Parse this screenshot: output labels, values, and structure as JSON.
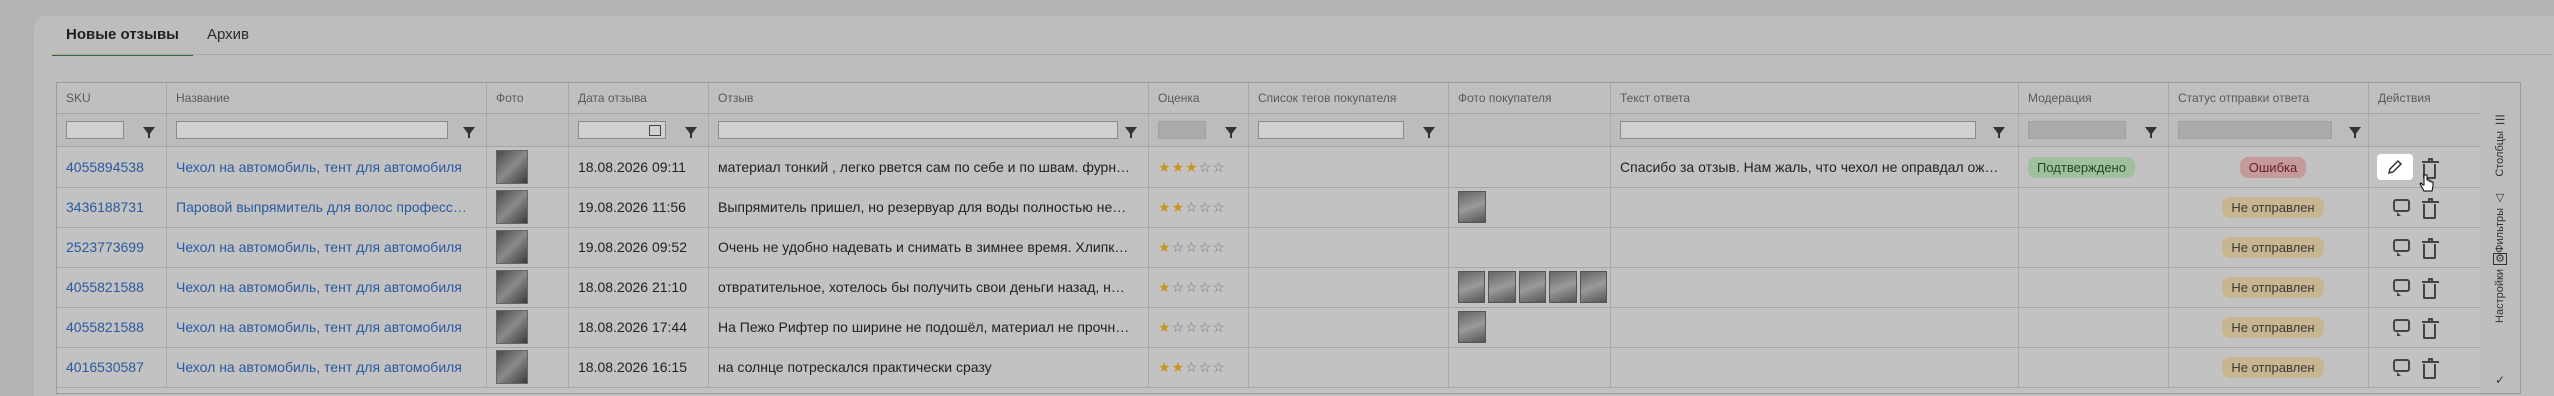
{
  "tabs": [
    {
      "label": "Новые отзывы",
      "active": true
    },
    {
      "label": "Архив",
      "active": false
    }
  ],
  "columns": [
    "SKU",
    "Название",
    "Фото",
    "Дата отзыва",
    "Отзыв",
    "Оценка",
    "Список тегов покупателя",
    "Фото покупателя",
    "Текст ответа",
    "Модерация",
    "Статус отправки ответа",
    "Действия"
  ],
  "rows": [
    {
      "sku": "4055894538",
      "name": "Чехол на автомобиль, тент для автомобиля",
      "date": "18.08.2026 09:11",
      "review": "материал тонкий , легко рвется сам по себе и по швам. фурн…",
      "stars": 3,
      "photos": 0,
      "answer": "Спасибо за отзыв. Нам жаль, что чехол не оправдал ож…",
      "moderation": "Подтверждено",
      "status": "Ошибка",
      "status_type": "err"
    },
    {
      "sku": "3436188731",
      "name": "Паровой выпрямитель для волос професс…",
      "date": "19.08.2026 11:56",
      "review": "Выпрямитель пришел, но резервуар для воды полностью не…",
      "stars": 2,
      "photos": 1,
      "answer": "",
      "moderation": "",
      "status": "Не отправлен",
      "status_type": "no"
    },
    {
      "sku": "2523773699",
      "name": "Чехол на автомобиль, тент для автомобиля",
      "date": "19.08.2026 09:52",
      "review": "Очень не удобно надевать и снимать в зимнее время. Хлипк…",
      "stars": 1,
      "photos": 0,
      "answer": "",
      "moderation": "",
      "status": "Не отправлен",
      "status_type": "no"
    },
    {
      "sku": "4055821588",
      "name": "Чехол на автомобиль, тент для автомобиля",
      "date": "18.08.2026 21:10",
      "review": "отвратительное, хотелось бы получить свои деньги назад, н…",
      "stars": 1,
      "photos": 5,
      "answer": "",
      "moderation": "",
      "status": "Не отправлен",
      "status_type": "no"
    },
    {
      "sku": "4055821588",
      "name": "Чехол на автомобиль, тент для автомобиля",
      "date": "18.08.2026 17:44",
      "review": "На Пежо Рифтер по ширине не подошёл, материал не прочн…",
      "stars": 1,
      "photos": 1,
      "answer": "",
      "moderation": "",
      "status": "Не отправлен",
      "status_type": "no"
    },
    {
      "sku": "4016530587",
      "name": "Чехол на автомобиль, тент для автомобиля",
      "date": "18.08.2026 16:15",
      "review": "на солнце потрескался практически сразу",
      "stars": 2,
      "photos": 0,
      "answer": "",
      "moderation": "",
      "status": "Не отправлен",
      "status_type": "no"
    }
  ],
  "side": {
    "columns": "Столбцы",
    "filters": "Фильтры",
    "settings": "Настройки"
  },
  "icons": [
    "funnel-icon",
    "calendar-icon",
    "comment-icon",
    "trash-icon",
    "pencil-icon",
    "columns-icon",
    "filter-icon",
    "settings-icon",
    "check-icon"
  ],
  "colors": {
    "link": "#2a5aa0",
    "star": "#c8961e",
    "ok": "#9fbf9f",
    "err": "#c49a9a",
    "no": "#c8b690",
    "tab_active": "#2d6a3c"
  }
}
